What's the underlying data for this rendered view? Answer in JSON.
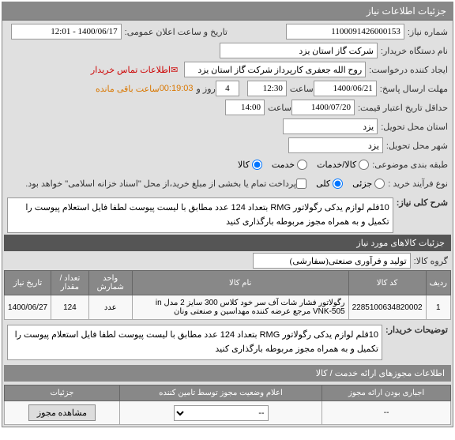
{
  "panel_title": "جزئیات اطلاعات نیاز",
  "fields": {
    "need_number_label": "شماره نیاز:",
    "need_number_value": "1100091426000153",
    "announce_label": "تاریخ و ساعت اعلان عمومی:",
    "announce_value": "1400/06/17 - 12:01",
    "buyer_label": "نام دستگاه خریدار:",
    "buyer_value": "شرکت گاز استان یزد",
    "requester_label": "ایجاد کننده درخواست:",
    "requester_value": "روح الله جعفری کارپرداز شرکت گاز استان یزد",
    "contact_link": "اطلاعات تماس خریدار",
    "reply_deadline_label": "مهلت ارسال پاسخ:",
    "reply_deadline_date": "1400/06/21",
    "time_label": "ساعت",
    "reply_deadline_time": "12:30",
    "days_label": "روز و",
    "days_value": "4",
    "remaining_label": "ساعت باقی مانده",
    "remaining_time": "00:19:03",
    "min_valid_label": "حداقل تاریخ اعتبار قیمت:",
    "min_valid_date": "1400/07/20",
    "min_valid_time": "14:00",
    "place_label": "استان محل تحویل:",
    "place_value": "یزد",
    "city_label": "شهر محل تحویل:",
    "city_value": "یزد",
    "cost_center_label": "طبقه بندی موضوعی:",
    "cost_type_goods": "کالا/خدمات",
    "cost_type_service": "خدمت",
    "cost_type_product": "کالا",
    "purchase_type_label": "نوع فرآیند خرید :",
    "purchase_partial": "جزئی",
    "purchase_full": "کلی",
    "payment_note": "پرداخت تمام یا بخشی از مبلغ خرید،از محل \"اسناد خزانه اسلامی\" خواهد بود."
  },
  "need_desc": {
    "label": "شرح کلی نیاز:",
    "text": "10قلم لوازم یدکی رگولاتور RMG بتعداد 124 عدد مطابق با لیست پیوست لطفا فایل استعلام پیوست را تکمیل و به همراه مجوز مربوطه  بارگذاری کنید"
  },
  "items_header": "جزئیات کالاهای مورد نیاز",
  "group_label": "گروه کالا:",
  "group_value": "تولید و فرآوری صنعتی(سفارشی)",
  "table": {
    "headers": [
      "ردیف",
      "کد کالا",
      "نام کالا",
      "واحد شمارش",
      "تعداد / مقدار",
      "تاریخ نیاز"
    ],
    "rows": [
      {
        "idx": "1",
        "code": "2285100634820002",
        "name": "رگولاتور فشار شات آف سر خود کلاس 300 سایز 2 مدل in VNK-505 مرجع عرضه کننده مهداسین و صنعتی ونان",
        "unit": "عدد",
        "qty": "124",
        "date": "1400/06/27"
      }
    ]
  },
  "buyer_notes_label": "توضیحات خریدار:",
  "buyer_notes_text": "10قلم لوازم یدکی رگولاتور RMG بتعداد 124 عدد مطابق با لیست پیوست لطفا فایل استعلام پیوست را تکمیل و به همراه مجوز مربوطه  بارگذاری کنید",
  "auth_header": "اطلاعات مجوزهای ارائه خدمت / کالا",
  "auth_table": {
    "headers": [
      "اجباری بودن ارائه مجوز",
      "اعلام وضعیت مجوز توسط تامین کننده",
      "جزئیات"
    ],
    "select_placeholder": "--",
    "mandatory": "--",
    "view_btn": "مشاهده مجوز"
  }
}
